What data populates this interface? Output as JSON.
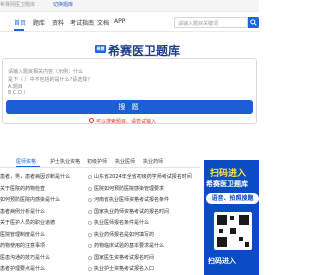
{
  "topbar": {
    "notice": "希赛网医卫题库",
    "link": "切换题库"
  },
  "nav": {
    "items": [
      "首页",
      "题库",
      "资料",
      "考试指南",
      "文档",
      "APP"
    ],
    "active_index": 0,
    "search_placeholder": "请输入题目关键词"
  },
  "brand": {
    "logo_text": "希赛",
    "title": "希赛医卫题库"
  },
  "search_panel": {
    "placeholder_lines": [
      "请输入题目相关内容（示例：什么",
      "是下（  ）中不包括的是什么?请选择？",
      "A.题目",
      "B.C.D.）"
    ],
    "submit_label": "搜 题",
    "hint": "可以搜索题目、请尝试输入"
  },
  "tabs": {
    "items": [
      "医师资格",
      "护士执业资格",
      "初级护师",
      "执业医师",
      "执业药师"
    ],
    "active_index": 0
  },
  "lists": {
    "left": [
      "患者，男，患者病因诊断是什么",
      "关于医院的药物检查",
      "如何预防医院内感染是什么",
      "患者病例分析是什么",
      "关于医护人员的职业道德",
      "医院管理制度是什么",
      "药物使用的注意事项",
      "医患沟通的技巧是什么",
      "患者护理要点是什么"
    ],
    "right": [
      "山东省2024年全省初级药学师考试报名时间",
      "医院如何预防医院感染管理要求",
      "河南省执业医师资格考试报名条件",
      "国家执业药师资格考试的报名时间",
      "执业医师报名条件是什么",
      "执业药师报名是如何填写的",
      "药物临床试验的基本要求是什么",
      "国家医生资格考试报名时间",
      "执业护士资格考试报名入口"
    ]
  },
  "promo": {
    "title1": "扫码进入",
    "title2": "希赛医卫题库",
    "pill": "语音、拍照搜题",
    "footer": "扫码进入"
  },
  "colors": {
    "primary": "#1a66e0",
    "brand_dark": "#1d3f8f",
    "promo_bg": "#0b4cc2",
    "promo_yellow": "#ffe14d",
    "hint_red": "#e03a2e"
  }
}
